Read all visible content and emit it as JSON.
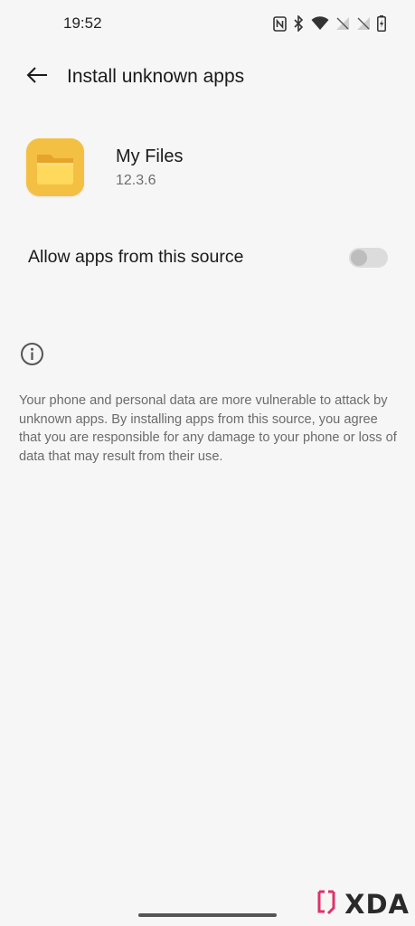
{
  "status_bar": {
    "time": "19:52",
    "icons": [
      "nfc-icon",
      "bluetooth-icon",
      "wifi-icon",
      "signal-1-icon",
      "signal-2-icon",
      "battery-charging-icon"
    ]
  },
  "header": {
    "back_icon": "arrow-left-icon",
    "title": "Install unknown apps"
  },
  "app": {
    "icon": "folder-icon",
    "name": "My Files",
    "version": "12.3.6"
  },
  "setting": {
    "label": "Allow apps from this source",
    "toggle_on": false
  },
  "info": {
    "icon": "info-icon",
    "text": "Your phone and personal data are more vulnerable to attack by unknown apps. By installing apps from this source, you agree that you are responsible for any damage to your phone or loss of data that may result from their use."
  },
  "watermark": {
    "text": "XDA"
  },
  "colors": {
    "background": "#f6f6f6",
    "app_icon_yellow": "#f2b534",
    "toggle_track_off": "#dcdcdc",
    "watermark_accent": "#e0316b"
  }
}
